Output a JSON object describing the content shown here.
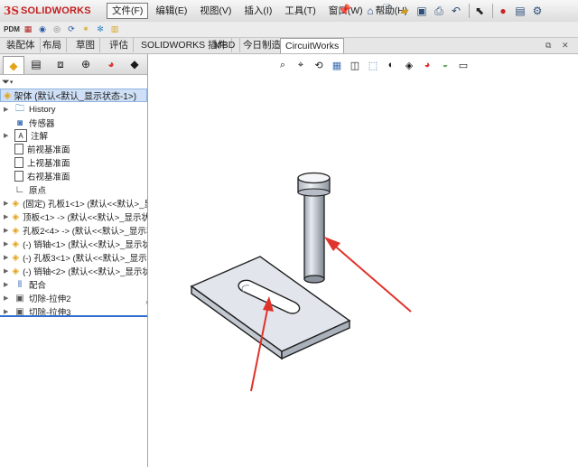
{
  "app": {
    "logo_mark": "3S",
    "brand": "SOLIDWORKS"
  },
  "menu": [
    {
      "label": "文件(F)",
      "active": true
    },
    {
      "label": "编辑(E)"
    },
    {
      "label": "视图(V)"
    },
    {
      "label": "插入(I)"
    },
    {
      "label": "工具(T)"
    },
    {
      "label": "窗口(W)"
    },
    {
      "label": "帮助(H)"
    }
  ],
  "pdm_label": "PDM",
  "command_tabs": [
    "装配体",
    "布局",
    "草图",
    "评估",
    "SOLIDWORKS 插件",
    "MBD",
    "今日制造",
    "CircuitWorks"
  ],
  "active_tab": "CircuitWorks",
  "feature_tree": {
    "root": "架体 (默认<默认_显示状态-1>)",
    "items": [
      {
        "label": "History",
        "icon": "history-icon",
        "expand": true
      },
      {
        "label": "传感器",
        "icon": "sensor-icon",
        "expand": false
      },
      {
        "label": "注解",
        "icon": "annotation-icon",
        "expand": true
      },
      {
        "label": "前视基准面",
        "icon": "plane-icon",
        "expand": false
      },
      {
        "label": "上视基准面",
        "icon": "plane-icon",
        "expand": false
      },
      {
        "label": "右视基准面",
        "icon": "plane-icon",
        "expand": false
      },
      {
        "label": "原点",
        "icon": "origin-icon",
        "expand": false
      },
      {
        "label": "(固定) 孔板1<1> (默认<<默认>_显",
        "icon": "part-icon",
        "expand": true
      },
      {
        "label": "顶板<1> -> (默认<<默认>_显示状",
        "icon": "part-icon",
        "expand": true
      },
      {
        "label": "孔板2<4> -> (默认<<默认>_显示状",
        "icon": "part-icon",
        "expand": true
      },
      {
        "label": "(-) 销轴<1> (默认<<默认>_显示状",
        "icon": "part-icon",
        "expand": true
      },
      {
        "label": "(-) 孔板3<1> (默认<<默认>_显示(",
        "icon": "part-icon",
        "expand": true
      },
      {
        "label": "(-) 销轴<2> (默认<<默认>_显示状",
        "icon": "part-icon",
        "expand": true
      },
      {
        "label": "配合",
        "icon": "mates-icon",
        "expand": true
      },
      {
        "label": "切除-拉伸2",
        "icon": "cut-extrude-icon",
        "expand": true
      },
      {
        "label": "切除-拉伸3",
        "icon": "cut-extrude-icon",
        "expand": true
      }
    ]
  },
  "colors": {
    "accent": "#2e6fd0",
    "arrow": "#e0332b",
    "logo": "#c41e1e",
    "part_icon": "#e3a21a"
  }
}
